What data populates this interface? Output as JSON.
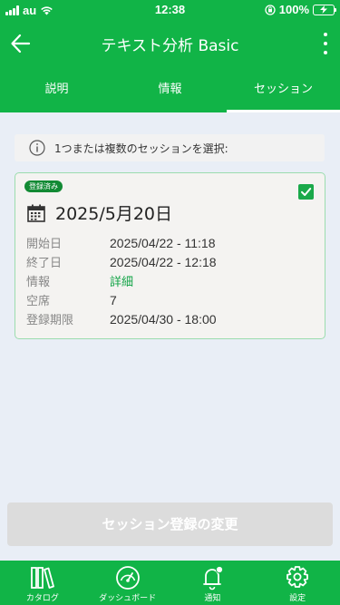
{
  "status_bar": {
    "carrier": "au",
    "time": "12:38",
    "battery": "100%"
  },
  "app_bar": {
    "title": "テキスト分析 Basic"
  },
  "tabs": [
    {
      "label": "説明"
    },
    {
      "label": "情報"
    },
    {
      "label": "セッション",
      "active": true
    }
  ],
  "info_banner": {
    "text": "1つまたは複数のセッションを選択:"
  },
  "session": {
    "badge": "登録済み",
    "date": "2025/5月20日",
    "selected": true,
    "rows": [
      {
        "key": "開始日",
        "value": "2025/04/22 - 11:18"
      },
      {
        "key": "終了日",
        "value": "2025/04/22 - 12:18"
      },
      {
        "key": "情報",
        "value": "詳細",
        "link": true
      },
      {
        "key": "空席",
        "value": "7"
      },
      {
        "key": "登録期限",
        "value": "2025/04/30 - 18:00"
      }
    ]
  },
  "submit_button": {
    "label": "セッション登録の変更",
    "disabled": true
  },
  "bottom_nav": [
    {
      "label": "カタログ",
      "icon": "books-icon"
    },
    {
      "label": "ダッシュボード",
      "icon": "gauge-icon"
    },
    {
      "label": "通知",
      "icon": "bell-icon"
    },
    {
      "label": "設定",
      "icon": "gear-icon"
    }
  ],
  "colors": {
    "brand_green": "#11b447",
    "badge_green": "#128a34",
    "link_green": "#13a447",
    "background": "#e9eef6"
  }
}
